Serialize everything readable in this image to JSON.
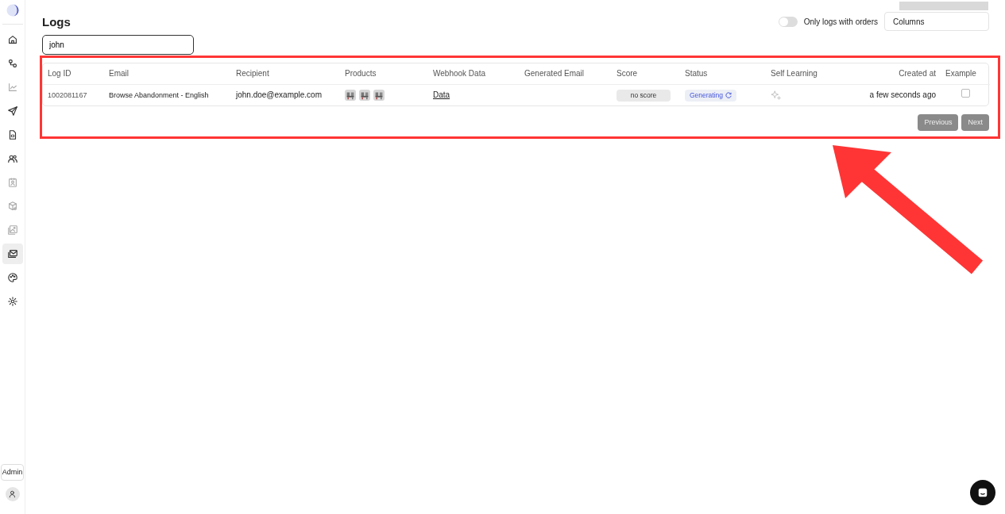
{
  "sidebar": {
    "items": [
      {
        "selected": false,
        "disabled": false
      },
      {
        "selected": false,
        "disabled": false
      },
      {
        "selected": false,
        "disabled": true
      },
      {
        "selected": false,
        "disabled": false
      },
      {
        "selected": false,
        "disabled": false
      },
      {
        "selected": false,
        "disabled": false
      },
      {
        "selected": false,
        "disabled": true
      },
      {
        "selected": false,
        "disabled": true
      },
      {
        "selected": false,
        "disabled": true
      },
      {
        "selected": true,
        "disabled": false
      },
      {
        "selected": false,
        "disabled": false
      },
      {
        "selected": false,
        "disabled": false
      }
    ],
    "admin_button": "Admin"
  },
  "page": {
    "title": "Logs",
    "search": {
      "value": "john"
    },
    "orders_toggle": {
      "label": "Only logs with orders",
      "on": false
    },
    "columns_select": {
      "label": "Columns"
    }
  },
  "table": {
    "columns": [
      "Log ID",
      "Email",
      "Recipient",
      "Products",
      "Webhook Data",
      "Generated Email",
      "Score",
      "Status",
      "Self Learning",
      "Created at",
      "Example"
    ],
    "rows": [
      {
        "log_id": "1002081167",
        "email": "Browse Abandonment - English",
        "recipient": "john.doe@example.com",
        "webhook_data": "Data",
        "score": "no score",
        "status": "Generating",
        "created_at": "a few seconds ago",
        "example": false
      }
    ]
  },
  "pagination": {
    "previous": "Previous",
    "next": "Next",
    "disabled": true
  }
}
